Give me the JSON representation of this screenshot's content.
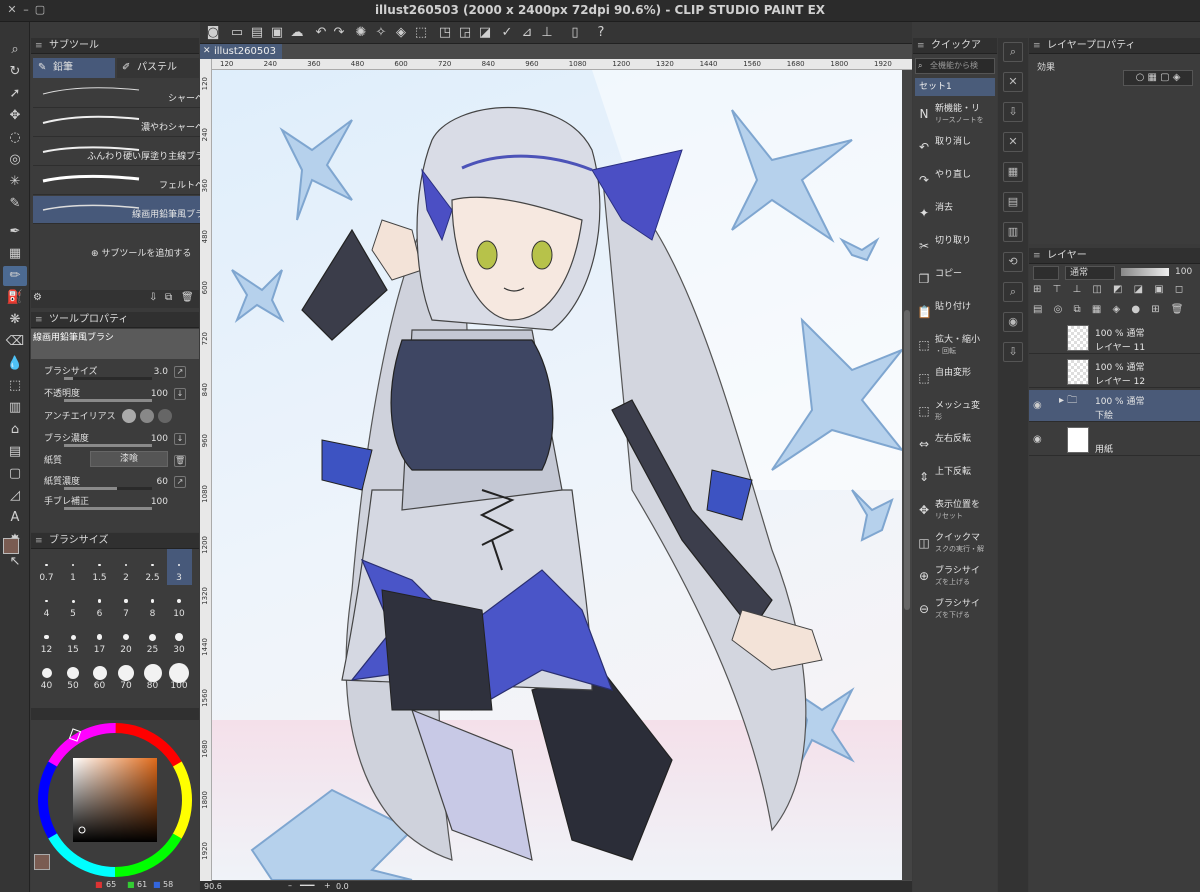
{
  "window": {
    "title": "illust260503 (2000 x 2400px 72dpi 90.6%)  - CLIP STUDIO PAINT EX"
  },
  "document": {
    "tab_label": "illust260503",
    "ruler_h": [
      "120",
      "240",
      "360",
      "480",
      "600",
      "720",
      "840",
      "960",
      "1080",
      "1200",
      "1320",
      "1440",
      "1560",
      "1680",
      "1800",
      "1920"
    ],
    "ruler_v": [
      "120",
      "240",
      "360",
      "480",
      "600",
      "720",
      "840",
      "960",
      "1080",
      "1200",
      "1320",
      "1440",
      "1560",
      "1680",
      "1800",
      "1920"
    ]
  },
  "subtool": {
    "header": "サブツール",
    "tabs": [
      "鉛筆",
      "パステル"
    ],
    "brushes": [
      {
        "label": "シャーペン"
      },
      {
        "label": "濃やわシャーペン"
      },
      {
        "label": "ふんわり硬い厚塗り主線ブラシ"
      },
      {
        "label": "フェルトペン"
      },
      {
        "label": "線画用鉛筆風ブラシ"
      }
    ],
    "add_label": "サブツールを追加する"
  },
  "tool_property": {
    "header": "ツールプロパティ",
    "brush_name": "線画用鉛筆風ブラシ",
    "rows": [
      {
        "label": "ブラシサイズ",
        "value": "3.0",
        "fill": 0.1
      },
      {
        "label": "不透明度",
        "value": "100",
        "fill": 1.0
      },
      {
        "label": "アンチエイリアス",
        "value": ""
      },
      {
        "label": "ブラシ濃度",
        "value": "100",
        "fill": 1.0
      },
      {
        "label": "紙質",
        "value": "",
        "button": "漆喰"
      },
      {
        "label": "紙質濃度",
        "value": "60",
        "fill": 0.6
      },
      {
        "label": "手ブレ補正",
        "value": "100",
        "fill": 1.0
      }
    ]
  },
  "brush_size": {
    "header": "ブラシサイズ",
    "sizes": [
      "0.7",
      "1",
      "1.5",
      "2",
      "2.5",
      "3",
      "4",
      "5",
      "6",
      "7",
      "8",
      "10",
      "12",
      "15",
      "17",
      "20",
      "25",
      "30",
      "40",
      "50",
      "60",
      "70",
      "80",
      "100"
    ],
    "selected": "3"
  },
  "color": {
    "r": "65",
    "g": "61",
    "b": "58",
    "main": "#7a5c52",
    "sub": "#ffffff",
    "hue_color": "#e06a1a"
  },
  "quick_access": {
    "header": "クイックア",
    "search_placeholder": "全機能から検",
    "set": "セット1",
    "items": [
      {
        "icon": "new-icon",
        "glyph": "N",
        "label": "新機能・リ",
        "sub": "リースノートを"
      },
      {
        "icon": "undo-icon",
        "glyph": "↶",
        "label": "取り消し"
      },
      {
        "icon": "redo-icon",
        "glyph": "↷",
        "label": "やり直し"
      },
      {
        "icon": "erase-icon",
        "glyph": "✦",
        "label": "消去"
      },
      {
        "icon": "cut-icon",
        "glyph": "✂",
        "label": "切り取り"
      },
      {
        "icon": "copy-icon",
        "glyph": "❐",
        "label": "コピー"
      },
      {
        "icon": "paste-icon",
        "glyph": "📋",
        "label": "貼り付け"
      },
      {
        "icon": "scale-icon",
        "glyph": "⬚",
        "label": "拡大・縮小",
        "sub": "・回転"
      },
      {
        "icon": "transform-icon",
        "glyph": "⬚",
        "label": "自由変形"
      },
      {
        "icon": "mesh-icon",
        "glyph": "⬚",
        "label": "メッシュ変",
        "sub": "形"
      },
      {
        "icon": "flip-h-icon",
        "glyph": "⇔",
        "label": "左右反転"
      },
      {
        "icon": "flip-v-icon",
        "glyph": "⇕",
        "label": "上下反転"
      },
      {
        "icon": "reset-view-icon",
        "glyph": "✥",
        "label": "表示位置を",
        "sub": "リセット"
      },
      {
        "icon": "quickmask-icon",
        "glyph": "◫",
        "label": "クイックマ",
        "sub": "スクの実行・解"
      },
      {
        "icon": "brush-up-icon",
        "glyph": "⊕",
        "label": "ブラシサイ",
        "sub": "ズを上げる"
      },
      {
        "icon": "brush-down-icon",
        "glyph": "⊖",
        "label": "ブラシサイ",
        "sub": "ズを下げる"
      }
    ]
  },
  "layer_property": {
    "header": "レイヤープロパティ",
    "effect_label": "効果"
  },
  "layers": {
    "header": "レイヤー",
    "blend_mode": "通常",
    "opacity": "100",
    "rows": [
      {
        "line1": "100 % 通常",
        "line2": "レイヤー 11",
        "thumb": "checker",
        "selected": false,
        "visible": false
      },
      {
        "line1": "100 % 通常",
        "line2": "レイヤー 12",
        "thumb": "checker",
        "selected": false,
        "visible": false
      },
      {
        "line1": "100 % 通常",
        "line2": "下絵",
        "thumb": "folder",
        "selected": true,
        "visible": true
      },
      {
        "line1": "",
        "line2": "用紙",
        "thumb": "white",
        "selected": false,
        "visible": true
      }
    ]
  },
  "status": {
    "zoom": "90.6",
    "rotation": "0.0"
  }
}
